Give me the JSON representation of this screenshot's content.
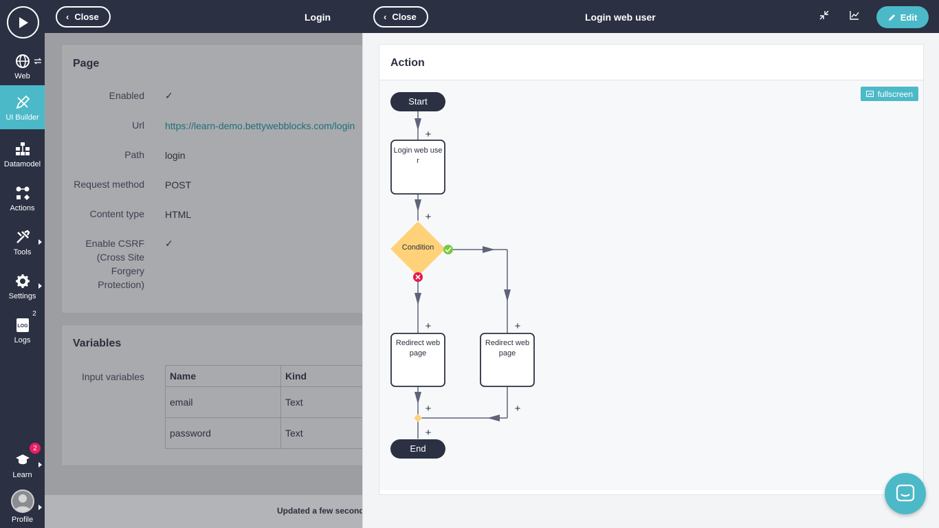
{
  "sidebar": {
    "items": [
      {
        "label": "Web",
        "icon": "globe-icon"
      },
      {
        "label": "UI Builder",
        "icon": "pencil-ruler-icon"
      },
      {
        "label": "Datamodel",
        "icon": "datamodel-icon"
      },
      {
        "label": "Actions",
        "icon": "actions-icon"
      },
      {
        "label": "Tools",
        "icon": "tools-icon"
      },
      {
        "label": "Settings",
        "icon": "gear-icon"
      },
      {
        "label": "Logs",
        "icon": "log-icon",
        "badge": "2"
      }
    ],
    "learn": {
      "label": "Learn",
      "badge": "2"
    },
    "profile": {
      "label": "Profile"
    }
  },
  "left_panel": {
    "close_label": "Close",
    "title": "Login",
    "page_card": {
      "title": "Page",
      "enabled_label": "Enabled",
      "enabled_value": "✓",
      "url_label": "Url",
      "url_value": "https://learn-demo.bettywebblocks.com/login",
      "path_label": "Path",
      "path_value": "login",
      "method_label": "Request method",
      "method_value": "POST",
      "content_type_label": "Content type",
      "content_type_value": "HTML",
      "csrf_label_lines": [
        "Enable CSRF",
        "(Cross Site",
        "Forgery",
        "Protection)"
      ],
      "csrf_value": "✓"
    },
    "variables_card": {
      "title": "Variables",
      "input_label": "Input variables",
      "columns": [
        "Name",
        "Kind"
      ],
      "rows": [
        [
          "email",
          "Text"
        ],
        [
          "password",
          "Text"
        ]
      ]
    },
    "footer": "Updated a few second"
  },
  "right_panel": {
    "close_label": "Close",
    "title": "Login web user",
    "edit_label": "Edit",
    "action_card_title": "Action",
    "fullscreen_label": "fullscreen",
    "flow": {
      "start": "Start",
      "end": "End",
      "step1": "Login web user",
      "condition": "Condition",
      "step_left": "Redirect web page",
      "step_right": "Redirect web page",
      "plus": "+"
    }
  },
  "colors": {
    "sidebar_bg": "#2b3042",
    "accent": "#4cb9c8",
    "condition": "#ffd27a",
    "success": "#7ac943",
    "error": "#e5194a"
  }
}
